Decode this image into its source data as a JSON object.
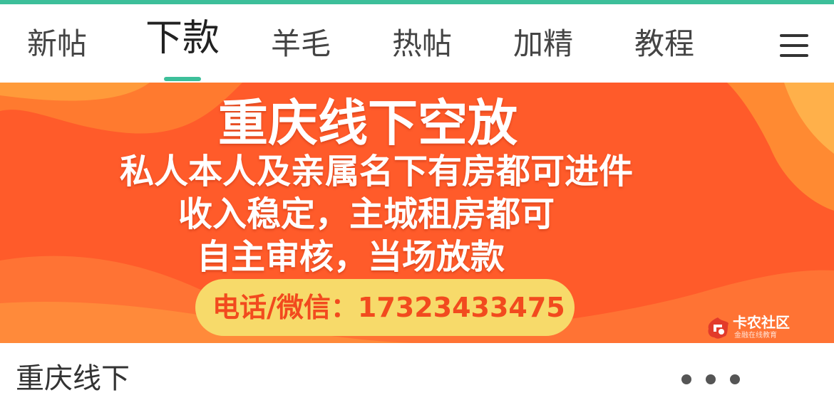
{
  "tabs": [
    {
      "label": "新帖",
      "active": false
    },
    {
      "label": "下款",
      "active": true
    },
    {
      "label": "羊毛",
      "active": false
    },
    {
      "label": "热帖",
      "active": false
    },
    {
      "label": "加精",
      "active": false
    },
    {
      "label": "教程",
      "active": false
    }
  ],
  "menu_icon": "hamburger-menu-icon",
  "banner": {
    "title": "重庆线下空放",
    "lines": [
      "私人本人及亲属名下有房都可进件",
      "收入稳定，主城租房都可",
      "自主审核，当场放款"
    ],
    "contact": "电话/微信：17323433475",
    "watermark": {
      "name": "卡农社区",
      "subtitle": "金融在线教育"
    }
  },
  "post": {
    "title": "重庆线下"
  },
  "colors": {
    "accent": "#3dbf9a",
    "banner_bg": "#ff5b2a",
    "pill_bg": "#f7da6a",
    "pill_text": "#f24a1e"
  }
}
